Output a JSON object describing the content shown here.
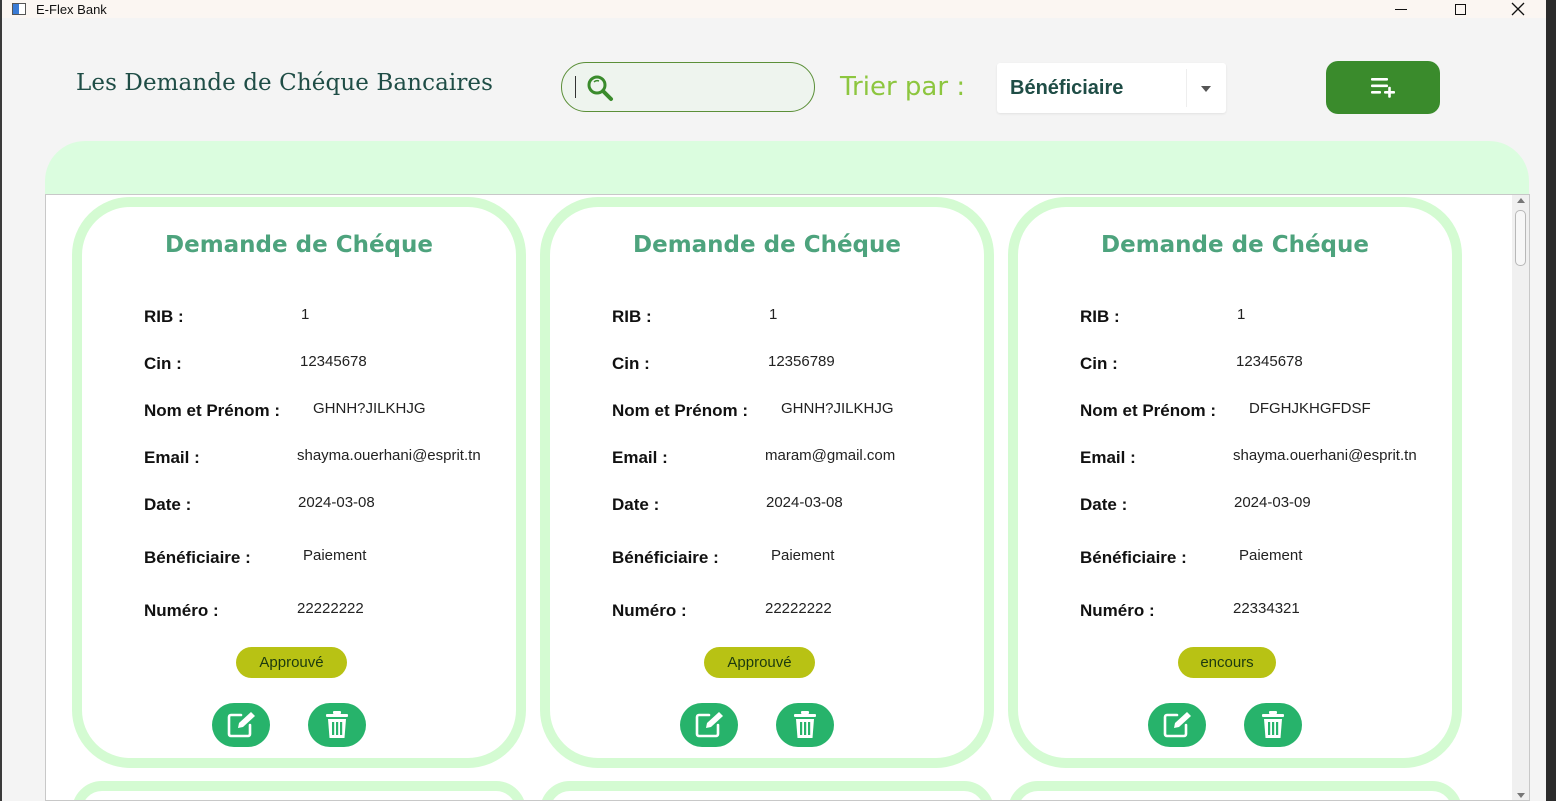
{
  "window": {
    "title": "E-Flex Bank"
  },
  "header": {
    "title": "Les Demande de Chéque Bancaires",
    "search": {
      "value": "",
      "placeholder": ""
    },
    "sort": {
      "label": "Trier par :",
      "selected": "Bénéficiaire"
    }
  },
  "colors": {
    "accent": "#3a8b2c",
    "band": "#dbfddf",
    "card_border": "#d4fbd2",
    "card_title": "#4da37d",
    "action_button": "#27b36b",
    "status_badge": "#b8c214"
  },
  "labels": {
    "rib": "RIB :",
    "cin": "Cin :",
    "nom": "Nom et Prénom :",
    "email": "Email :",
    "date": "Date  :",
    "beneficiaire": "Bénéficiaire :",
    "numero": "Numéro  :"
  },
  "cards": [
    {
      "title": "Demande de Chéque",
      "rib": "1",
      "cin": "12345678",
      "nom": "GHNH?JILKHJG",
      "email": "shayma.ouerhani@esprit.tn",
      "date": "2024-03-08",
      "beneficiaire": "Paiement",
      "numero": "22222222",
      "status": "Approuvé"
    },
    {
      "title": "Demande de Chéque",
      "rib": "1",
      "cin": "12356789",
      "nom": "GHNH?JILKHJG",
      "email": "maram@gmail.com",
      "date": "2024-03-08",
      "beneficiaire": "Paiement",
      "numero": "22222222",
      "status": "Approuvé"
    },
    {
      "title": "Demande de Chéque",
      "rib": "1",
      "cin": "12345678",
      "nom": "DFGHJKHGFDSF",
      "email": "shayma.ouerhani@esprit.tn",
      "date": "2024-03-09",
      "beneficiaire": "Paiement",
      "numero": "22334321",
      "status": "encours"
    }
  ],
  "icons": {
    "search": "search-icon",
    "add_list": "playlist-add-icon",
    "edit": "edit-icon",
    "delete": "trash-icon"
  }
}
